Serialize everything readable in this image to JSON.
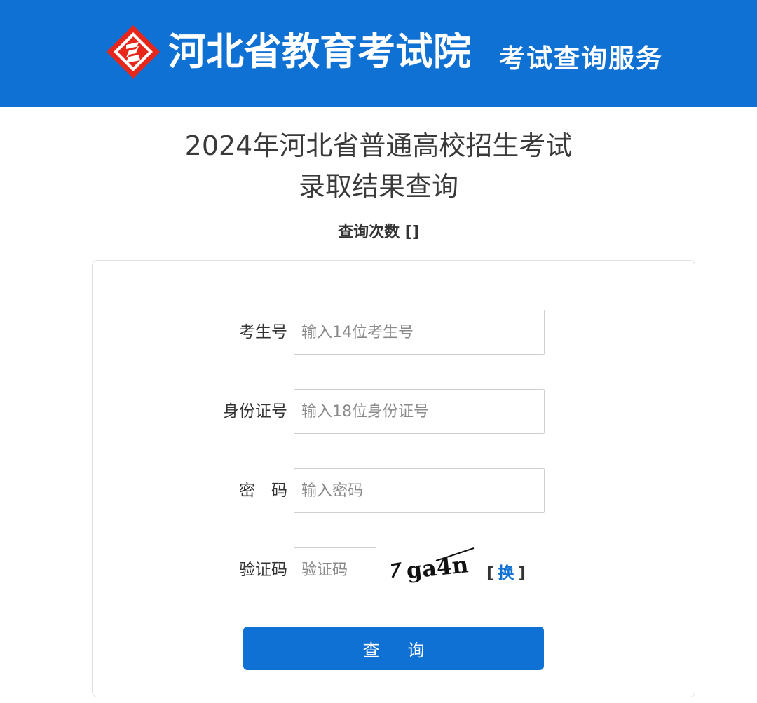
{
  "header": {
    "brand_title": "河北省教育考试院",
    "brand_subtitle": "考试查询服务",
    "logo_icon": "hebei-exam-logo-icon",
    "colors": {
      "primary": "#1071d4",
      "logo_red": "#e8271b"
    }
  },
  "page": {
    "title_line1": "2024年河北省普通高校招生考试",
    "title_line2": "录取结果查询",
    "query_count": "查询次数 []"
  },
  "form": {
    "exam_no": {
      "label": "考生号",
      "placeholder": "输入14位考生号",
      "value": ""
    },
    "id_no": {
      "label": "身份证号",
      "placeholder": "输入18位身份证号",
      "value": ""
    },
    "password": {
      "label": "密　码",
      "placeholder": "输入密码",
      "value": ""
    },
    "captcha": {
      "label": "验证码",
      "placeholder": "验证码",
      "value": "",
      "image_text": "ga4n",
      "refresh_open": "[",
      "refresh_label": "换",
      "refresh_close": "]"
    },
    "submit_label": "查询"
  }
}
